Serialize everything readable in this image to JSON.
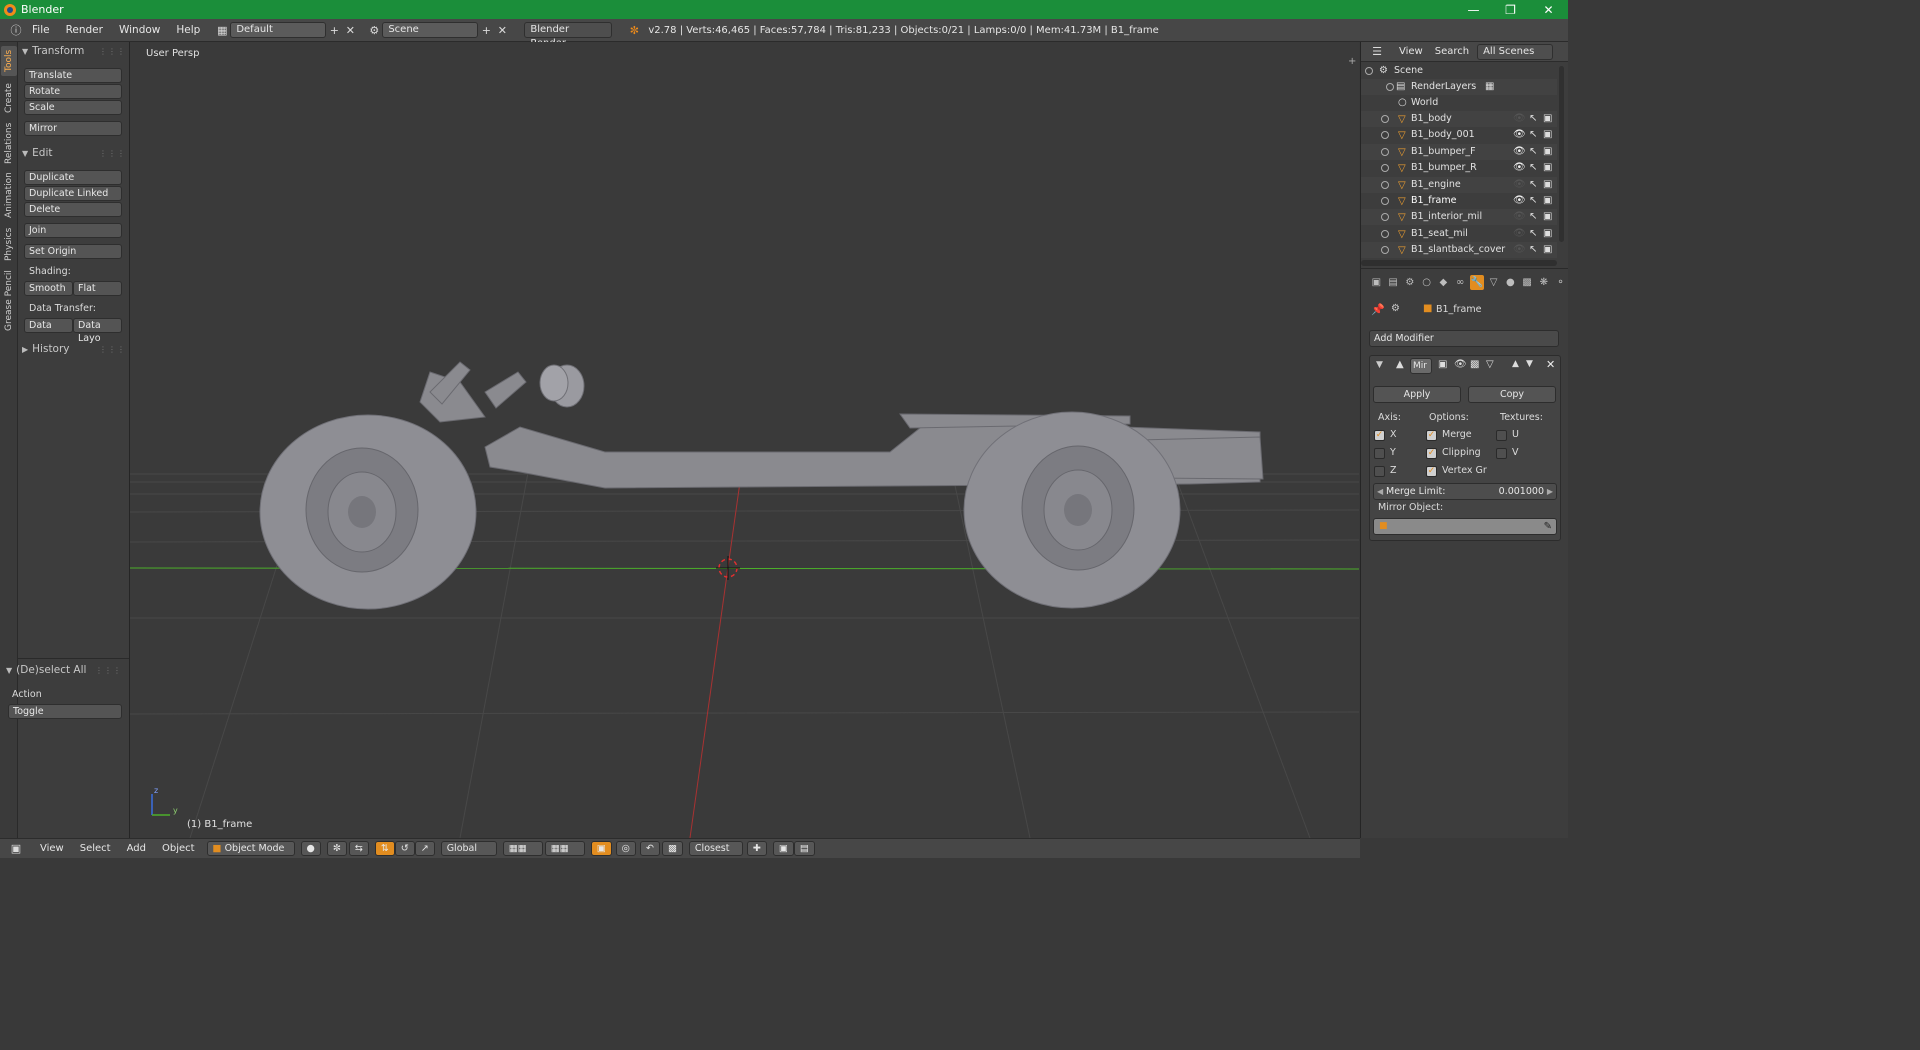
{
  "window": {
    "title": "Blender",
    "minimize_icon": "minimize-icon",
    "maximize_icon": "restore-icon",
    "close_icon": "close-icon"
  },
  "infobar": {
    "menus": [
      "File",
      "Render",
      "Window",
      "Help"
    ],
    "screen_layout": "Default",
    "scene": "Scene",
    "render_engine": "Blender Render",
    "stats": "v2.78 | Verts:46,465 | Faces:57,784 | Tris:81,233 | Objects:0/21 | Lamps:0/0 | Mem:41.73M | B1_frame"
  },
  "toolshelf": {
    "tabs": [
      "Tools",
      "Create",
      "Relations",
      "Animation",
      "Physics",
      "Grease Pencil"
    ],
    "transform_header": "Transform",
    "transform": [
      "Translate",
      "Rotate",
      "Scale"
    ],
    "mirror": "Mirror",
    "edit_header": "Edit",
    "edit": [
      "Duplicate",
      "Duplicate Linked",
      "Delete"
    ],
    "join": "Join",
    "set_origin": "Set Origin",
    "shading_label": "Shading:",
    "smooth": "Smooth",
    "flat": "Flat",
    "data_transfer_label": "Data Transfer:",
    "data": "Data",
    "data_layout": "Data Layo",
    "history_header": "History",
    "operator_header": "(De)select All",
    "action_label": "Action",
    "action_value": "Toggle"
  },
  "viewport": {
    "view_name": "User Persp",
    "active_object": "(1) B1_frame",
    "axis_z": "z",
    "axis_y": "y"
  },
  "outliner": {
    "menus": [
      "View",
      "Search"
    ],
    "filter": "All Scenes",
    "scene": "Scene",
    "render_layers": "RenderLayers",
    "world": "World",
    "objects": [
      "B1_body",
      "B1_body_001",
      "B1_bumper_F",
      "B1_bumper_R",
      "B1_engine",
      "B1_frame",
      "B1_interior_mil",
      "B1_seat_mil",
      "B1_slantback_cover"
    ]
  },
  "properties": {
    "context_object": "B1_frame",
    "add_modifier": "Add Modifier",
    "modifier_name": "Mir",
    "apply": "Apply",
    "copy": "Copy",
    "axis_label": "Axis:",
    "options_label": "Options:",
    "textures_label": "Textures:",
    "axis": [
      {
        "name": "X",
        "checked": true
      },
      {
        "name": "Y",
        "checked": false
      },
      {
        "name": "Z",
        "checked": false
      }
    ],
    "options": [
      {
        "name": "Merge",
        "checked": true
      },
      {
        "name": "Clipping",
        "checked": true
      },
      {
        "name": "Vertex Gr",
        "checked": true
      }
    ],
    "textures": [
      {
        "name": "U",
        "checked": false
      },
      {
        "name": "V",
        "checked": false
      }
    ],
    "merge_limit_label": "Merge Limit:",
    "merge_limit_value": "0.001000",
    "mirror_object_label": "Mirror Object:"
  },
  "footer": {
    "menus": [
      "View",
      "Select",
      "Add",
      "Object"
    ],
    "mode": "Object Mode",
    "orientation": "Global",
    "snap_target": "Closest"
  },
  "colors": {
    "titlebar": "#1b8e3a",
    "accent": "#e28d20",
    "x_axis": "#a83232",
    "y_axis": "#4caf2a"
  }
}
